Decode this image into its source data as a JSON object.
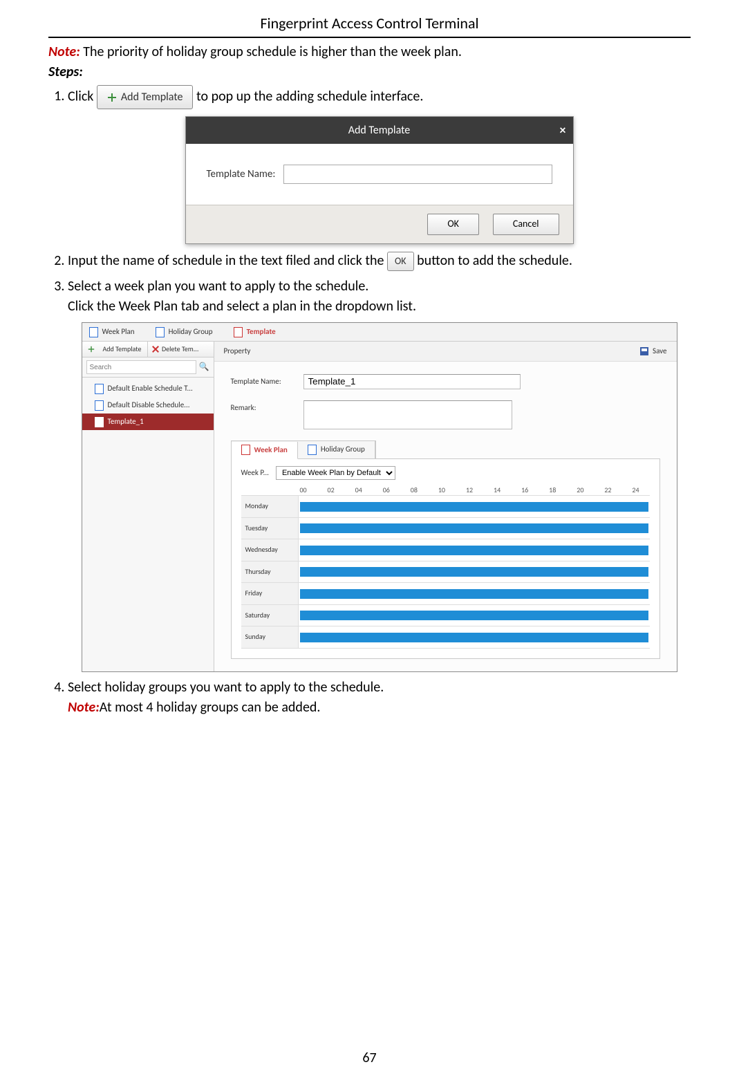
{
  "header": "Fingerprint Access Control Terminal",
  "note_label": "Note:",
  "note_text": " The priority of holiday group schedule is higher than the week plan.",
  "steps_label": "Steps:",
  "steps": {
    "s1_a": "Click ",
    "s1_btn": "Add Template",
    "s1_b": " to pop up the adding schedule interface.",
    "s2_a": "Input the name of schedule in the text filed and click the ",
    "s2_btn": "OK",
    "s2_b": " button to add the schedule.",
    "s3_a": "Select a week plan you want to apply to the schedule.",
    "s3_b": "Click the Week Plan tab and select a plan in the dropdown list.",
    "s4_a": "Select holiday groups you want to apply to the schedule.",
    "s4_note_label": "Note:",
    "s4_b": "At most 4 holiday groups can be added."
  },
  "dlg": {
    "title": "Add Template",
    "label": "Template Name:",
    "ok": "OK",
    "cancel": "Cancel",
    "close": "×"
  },
  "editor": {
    "top_tabs": {
      "week_plan": "Week Plan",
      "holiday_group": "Holiday Group",
      "template": "Template"
    },
    "side_tools": {
      "add": "Add Template",
      "del": "Delete Tem..."
    },
    "search_placeholder": "Search",
    "tree": [
      "Default Enable Schedule T...",
      "Default Disable Schedule...",
      "Template_1"
    ],
    "property_label": "Property",
    "save": "Save",
    "form": {
      "tpl_name_label": "Template Name:",
      "tpl_name_value": "Template_1",
      "remark_label": "Remark:"
    },
    "sub_tabs": {
      "week_plan": "Week Plan",
      "holiday_group": "Holiday Group"
    },
    "wp_label": "Week P...",
    "wp_select": "Enable Week Plan by Default",
    "hours": [
      "00",
      "02",
      "04",
      "06",
      "08",
      "10",
      "12",
      "14",
      "16",
      "18",
      "20",
      "22",
      "24"
    ],
    "days": [
      "Monday",
      "Tuesday",
      "Wednesday",
      "Thursday",
      "Friday",
      "Saturday",
      "Sunday"
    ]
  },
  "page_number": "67"
}
